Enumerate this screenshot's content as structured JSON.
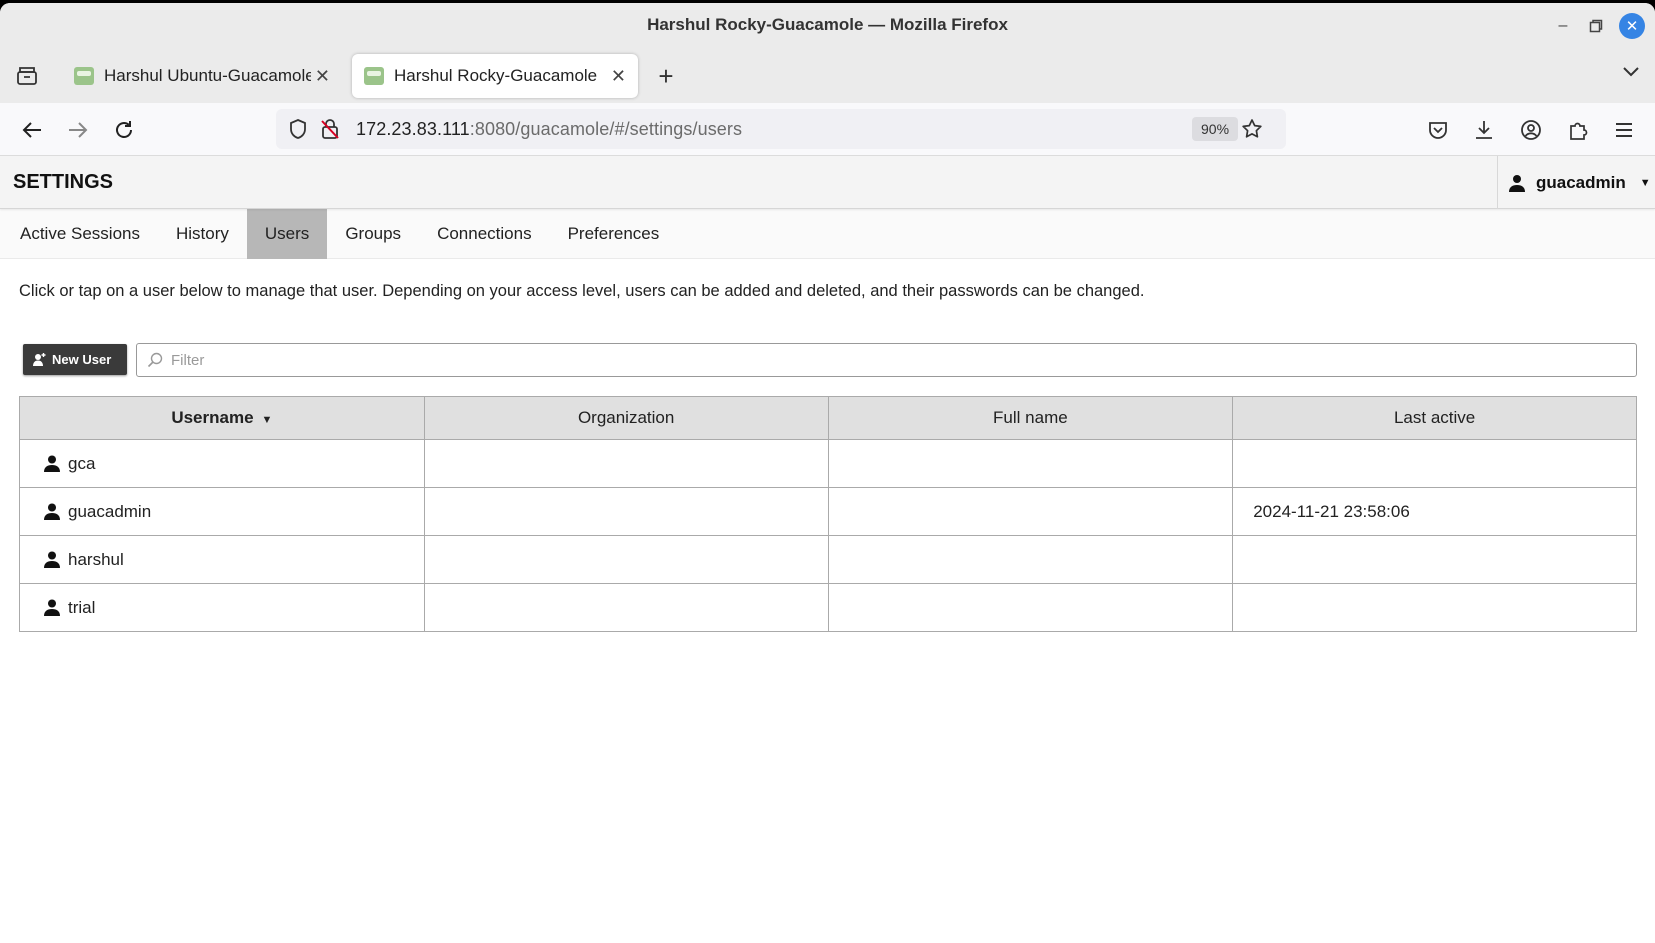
{
  "window": {
    "title": "Harshul Rocky-Guacamole — Mozilla Firefox"
  },
  "tabs": [
    {
      "label": "Harshul Ubuntu-Guacamole",
      "active": false
    },
    {
      "label": "Harshul Rocky-Guacamole",
      "active": true
    }
  ],
  "nav": {
    "url_host": "172.23.83.111",
    "url_rest": ":8080/guacamole/#/settings/users",
    "zoom": "90%"
  },
  "header": {
    "page_title": "SETTINGS",
    "user": "guacadmin"
  },
  "settings_tabs": [
    {
      "label": "Active Sessions"
    },
    {
      "label": "History"
    },
    {
      "label": "Users",
      "active": true
    },
    {
      "label": "Groups"
    },
    {
      "label": "Connections"
    },
    {
      "label": "Preferences"
    }
  ],
  "description": "Click or tap on a user below to manage that user. Depending on your access level, users can be added and deleted, and their passwords can be changed.",
  "toolbar": {
    "new_user_label": "New User",
    "filter_placeholder": "Filter"
  },
  "table": {
    "columns": [
      "Username",
      "Organization",
      "Full name",
      "Last active"
    ],
    "rows": [
      {
        "username": "gca",
        "organization": "",
        "full_name": "",
        "last_active": ""
      },
      {
        "username": "guacadmin",
        "organization": "",
        "full_name": "",
        "last_active": "2024-11-21 23:58:06"
      },
      {
        "username": "harshul",
        "organization": "",
        "full_name": "",
        "last_active": ""
      },
      {
        "username": "trial",
        "organization": "",
        "full_name": "",
        "last_active": ""
      }
    ]
  },
  "colors": {
    "active_tab_bg": "#b7b7b7",
    "new_user_btn_bg": "#3a3a3a",
    "table_header_bg": "#e0e0e0",
    "close_btn": "#3584e4"
  }
}
